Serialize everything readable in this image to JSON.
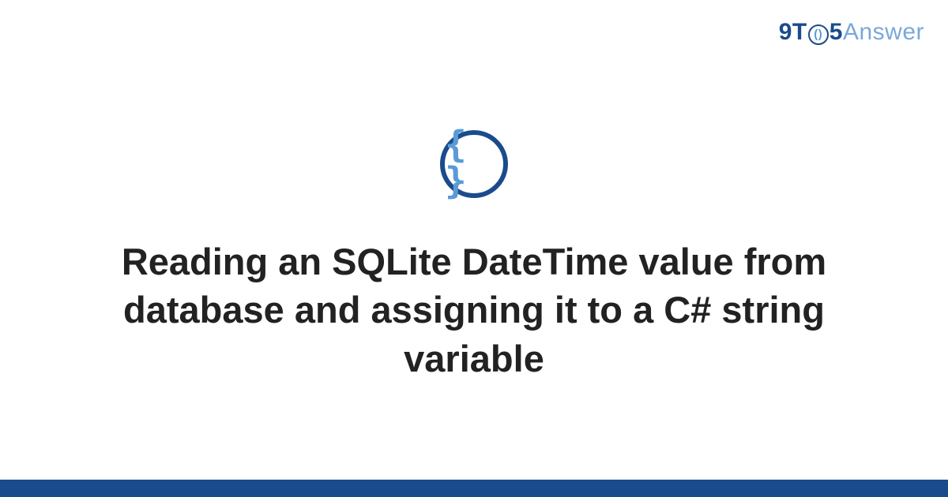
{
  "logo": {
    "part1": "9T",
    "circle_inner": "()",
    "part2": "5",
    "part3": "Answer"
  },
  "icon": {
    "name": "code-braces-icon",
    "glyph": "{ }"
  },
  "title": "Reading an SQLite DateTime value from database and assigning it to a C# string variable",
  "colors": {
    "primary": "#1a4b8c",
    "accent": "#5a9bd5"
  }
}
